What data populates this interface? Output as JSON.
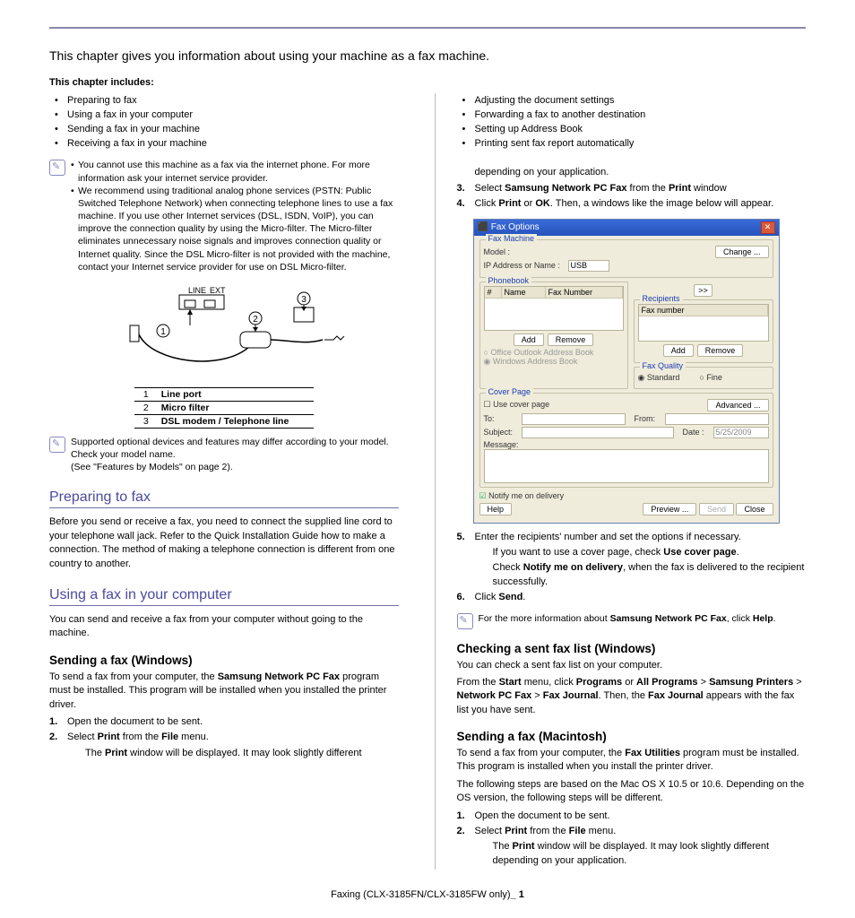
{
  "intro": "This chapter gives you information about using your machine as a fax machine.",
  "includes_head": "This chapter includes:",
  "left_bullets": [
    "Preparing to fax",
    "Using a fax in your computer",
    "Sending a fax in your machine",
    "Receiving a fax in your machine"
  ],
  "right_bullets": [
    "Adjusting the document settings",
    "Forwarding a fax to another destination",
    "Setting up Address Book",
    "Printing sent fax report automatically"
  ],
  "note1": {
    "a": "You cannot use this machine as a fax via the internet phone. For more information ask your internet service provider.",
    "b": "We recommend using traditional analog phone services (PSTN: Public Switched Telephone Network) when connecting telephone lines to use a fax machine. If you use other Internet services (DSL, ISDN, VoIP), you can improve the connection quality by using the Micro-filter. The Micro-filter eliminates unnecessary noise signals and improves connection quality or Internet quality. Since the DSL Micro-filter is not provided with the machine, contact your Internet service provider for use on DSL Micro-filter."
  },
  "diag_labels": {
    "line": "LINE",
    "ext": "EXT"
  },
  "key": {
    "k1": "Line port",
    "k2": "Micro filter",
    "k3": "DSL modem / Telephone line"
  },
  "note2": {
    "text": "Supported optional devices and features may differ according to your model. Check your model name.",
    "see": "(See \"Features by Models\" on page 2)."
  },
  "h_prepare": "Preparing to fax",
  "prepare_body": "Before you send or receive a fax, you need to connect the supplied line cord to your telephone wall jack. Refer to the Quick Installation Guide how to make a connection. The method of making a telephone connection is different from one country to another.",
  "h_using": "Using a fax in your computer",
  "using_body": "You can send and receive a fax from your computer without going to the machine.",
  "h_send_win": "Sending a fax (Windows)",
  "send_win_intro_a": "To send a fax from your computer, the ",
  "send_win_intro_b": "Samsung Network PC Fax",
  "send_win_intro_c": " program must be installed. This program will be installed when you installed the printer driver.",
  "steps_win": {
    "s1": "Open the document to be sent.",
    "s2a": "Select ",
    "s2b": "Print",
    "s2c": " from the ",
    "s2d": "File",
    "s2e": " menu.",
    "s2sub_a": "The ",
    "s2sub_b": "Print",
    "s2sub_c": " window will be displayed. It may look slightly different"
  },
  "r_dep": "depending on your application.",
  "r_s3_a": "Select ",
  "r_s3_b": "Samsung Network PC Fax",
  "r_s3_c": " from the ",
  "r_s3_d": "Print",
  "r_s3_e": " window",
  "r_s4_a": "Click ",
  "r_s4_b": "Print",
  "r_s4_c": " or ",
  "r_s4_d": "OK",
  "r_s4_e": ". Then, a windows like the image below will appear.",
  "dlg": {
    "title": "Fax Options",
    "fax_machine": "Fax Machine",
    "model": "Model :",
    "ip": "IP Address or Name :",
    "usb": "USB",
    "change": "Change ...",
    "phonebook": "Phonebook",
    "recipients": "Recipients",
    "hash": "#",
    "name": "Name",
    "faxnum": "Fax Number",
    "faxnum2": "Fax number",
    "add": "Add",
    "remove": "Remove",
    "to_arrow": ">>",
    "office": "Office Outlook Address Book",
    "winaddr": "Windows Address Book",
    "quality": "Fax Quality",
    "standard": "Standard",
    "fine": "Fine",
    "cover": "Cover Page",
    "usecover": "Use cover page",
    "advanced": "Advanced ...",
    "to": "To:",
    "from": "From:",
    "subject": "Subject:",
    "date": "Date :",
    "dateval": "5/25/2009",
    "message": "Message:",
    "notify": "Notify me on delivery",
    "help": "Help",
    "preview": "Preview ...",
    "send": "Send",
    "close": "Close"
  },
  "r_s5_a": "Enter the recipients' number and set the options if necessary.",
  "r_s5_sub1_a": "If you want to use a cover page, check ",
  "r_s5_sub1_b": "Use cover page",
  "r_s5_sub2_a": "Check ",
  "r_s5_sub2_b": "Notify me on delivery",
  "r_s5_sub2_c": ", when the fax is delivered to the recipient successfully.",
  "r_s6_a": "Click ",
  "r_s6_b": "Send",
  "note3_a": "For the more information about ",
  "note3_b": "Samsung Network PC Fax",
  "note3_c": ", click ",
  "note3_d": "Help",
  "h_check": "Checking a sent fax list (Windows)",
  "check_line": "You can check a sent fax list on your computer.",
  "check_body_a": "From the ",
  "check_body_b": "Start",
  "check_body_c": " menu, click ",
  "check_body_d": "Programs",
  "check_body_e": " or ",
  "check_body_f": "All Programs",
  "check_body_g": " > ",
  "check_body_h": "Samsung Printers",
  "check_body_i": " > ",
  "check_body_j": "Network PC Fax",
  "check_body_k": " > ",
  "check_body_l": "Fax Journal",
  "check_body_m": ". Then, the ",
  "check_body_n": "Fax Journal",
  "check_body_o": " appears with the fax list you have sent.",
  "h_mac": "Sending a fax (Macintosh)",
  "mac_intro_a": "To send a fax from your computer, the ",
  "mac_intro_b": "Fax Utilities",
  "mac_intro_c": " program must be installed. This program is installed when you install the printer driver.",
  "mac_intro2": "The following steps are based on the Mac OS X 10.5 or 10.6. Depending on the OS version, the following steps will be different.",
  "mac_s1": "Open the document to be sent.",
  "mac_s2_a": "Select ",
  "mac_s2_b": "Print",
  "mac_s2_c": " from the ",
  "mac_s2_d": "File",
  "mac_s2_e": " menu.",
  "mac_sub_a": "The ",
  "mac_sub_b": "Print",
  "mac_sub_c": " window will be displayed. It may look slightly different depending on your application.",
  "footer_a": "Faxing (CLX-3185FN/CLX-3185FW only)",
  "footer_b": "_ 1"
}
